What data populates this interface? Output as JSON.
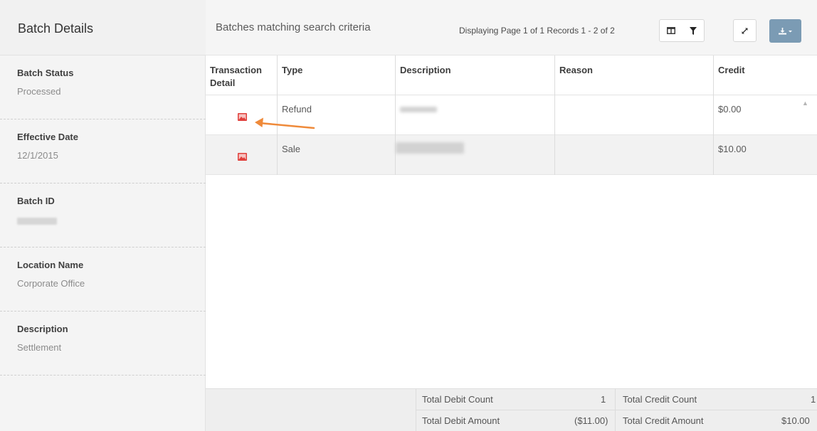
{
  "left_panel": {
    "title": "Batch Details",
    "fields": [
      {
        "label": "Batch Status",
        "value": "Processed"
      },
      {
        "label": "Effective Date",
        "value": "12/1/2015"
      },
      {
        "label": "Batch ID",
        "value": ""
      },
      {
        "label": "Location Name",
        "value": "Corporate Office"
      },
      {
        "label": "Description",
        "value": "Settlement"
      }
    ]
  },
  "main": {
    "subtitle": "Batches matching search criteria",
    "paging": "Displaying Page 1 of 1 Records 1 - 2 of 2",
    "icons": {
      "columns": "columns-icon",
      "filter": "filter-icon",
      "expand": "expand-icon",
      "download": "download-icon"
    },
    "accent_color": "#7b9bb4"
  },
  "grid": {
    "columns": [
      "Transaction\nDetail",
      "Type",
      "Description",
      "Reason",
      "Credit"
    ],
    "rows": [
      {
        "type": "Refund",
        "description": "",
        "reason": "",
        "credit": "$0.00"
      },
      {
        "type": "Sale",
        "description": "",
        "reason": "",
        "credit": "$10.00"
      }
    ],
    "icon_color": "#e0403c",
    "annotation_color": "#ef8a3a"
  },
  "footer": {
    "total_debit_count_label": "Total Debit Count",
    "total_debit_count": "1",
    "total_credit_count_label": "Total Credit Count",
    "total_credit_count": "1",
    "total_debit_amount_label": "Total Debit Amount",
    "total_debit_amount": "($11.00)",
    "total_credit_amount_label": "Total Credit Amount",
    "total_credit_amount": "$10.00"
  }
}
